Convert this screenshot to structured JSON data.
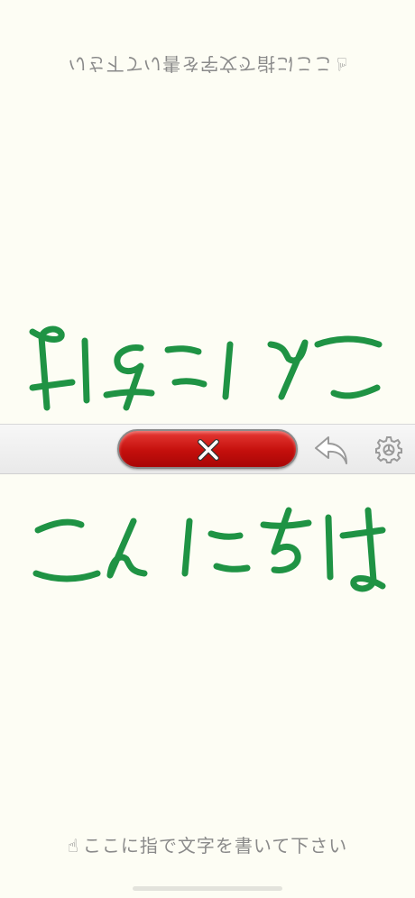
{
  "top_pane": {
    "hint_emoji": "☝",
    "hint_text": "ここに指で文字を書いて下さい",
    "ink_description": "handwritten: こんにちは (upside down)"
  },
  "bottom_pane": {
    "hint_emoji": "☝",
    "hint_text": "ここに指で文字を書いて下さい",
    "ink_description": "handwritten: こんにちは"
  },
  "toolbar": {
    "clear_icon": "close-icon",
    "undo_icon": "undo-arrow-icon",
    "settings_icon": "gear-icon"
  },
  "colors": {
    "background": "#fdfdf4",
    "ink": "#1f9344",
    "clear_button": "#c40f0c",
    "hint_text": "#8a8a8a"
  }
}
